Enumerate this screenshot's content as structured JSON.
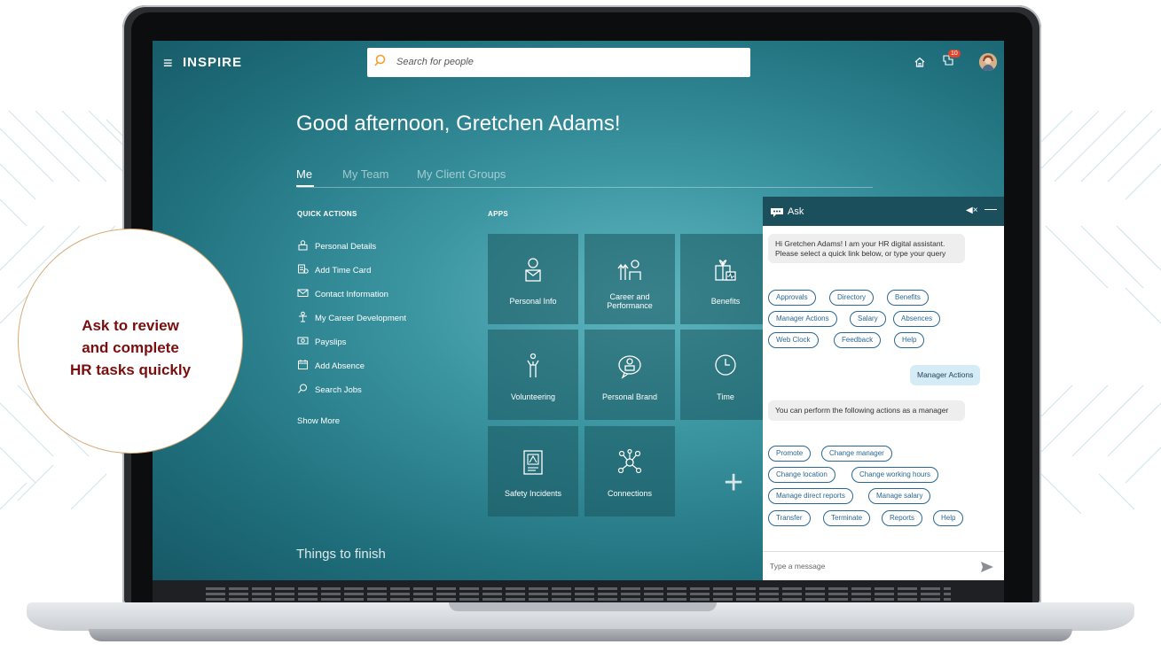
{
  "app": {
    "logo": "INSPIRE",
    "search_placeholder": "Search for people",
    "notification_count": "10"
  },
  "greeting": "Good afternoon, Gretchen Adams!",
  "tabs": [
    {
      "label": "Me"
    },
    {
      "label": "My Team"
    },
    {
      "label": "My Client Groups"
    }
  ],
  "quick_actions": {
    "title": "QUICK ACTIONS",
    "items": [
      {
        "label": "Personal Details",
        "icon": "person-doc-icon"
      },
      {
        "label": "Add Time Card",
        "icon": "time-card-icon"
      },
      {
        "label": "Contact Information",
        "icon": "envelope-icon"
      },
      {
        "label": "My Career Development",
        "icon": "career-icon"
      },
      {
        "label": "Payslips",
        "icon": "payslip-icon"
      },
      {
        "label": "Add Absence",
        "icon": "calendar-icon"
      },
      {
        "label": "Search Jobs",
        "icon": "search-icon"
      }
    ],
    "show_more": "Show More"
  },
  "apps": {
    "title": "APPS",
    "tiles": [
      {
        "label": "Personal Info",
        "icon": "personal-info-icon"
      },
      {
        "label": "Career and\nPerformance",
        "icon": "career-performance-icon"
      },
      {
        "label": "Benefits",
        "icon": "benefits-icon"
      },
      {
        "label": "Volunteering",
        "icon": "volunteering-icon"
      },
      {
        "label": "Personal Brand",
        "icon": "personal-brand-icon"
      },
      {
        "label": "Time",
        "icon": "clock-icon"
      },
      {
        "label": "Safety Incidents",
        "icon": "safety-icon"
      },
      {
        "label": "Connections",
        "icon": "connections-icon"
      }
    ]
  },
  "things_to_finish": "Things to finish",
  "chat": {
    "title": "Ask",
    "greeting": "Hi Gretchen Adams! I am your HR digital assistant. Please select a quick link below, or type your query",
    "quick_links": [
      "Approvals",
      "Directory",
      "Benefits",
      "Manager Actions",
      "Salary",
      "Absences",
      "Web Clock",
      "Feedback",
      "Help"
    ],
    "user_message": "Manager Actions",
    "reply": "You can perform the following actions as a manager",
    "manager_actions": [
      "Promote",
      "Change manager",
      "Change location",
      "Change working hours",
      "Manage direct reports",
      "Manage salary",
      "Transfer",
      "Terminate",
      "Reports",
      "Help"
    ],
    "input_placeholder": "Type a message"
  },
  "callout": {
    "line1": "Ask to review",
    "line2": "and complete",
    "line3": "HR tasks quickly"
  },
  "colors": {
    "accent": "#2b6794",
    "chat_header": "#1b4f5c",
    "callout_text": "#7a0e0e",
    "callout_border": "#d9a978"
  }
}
